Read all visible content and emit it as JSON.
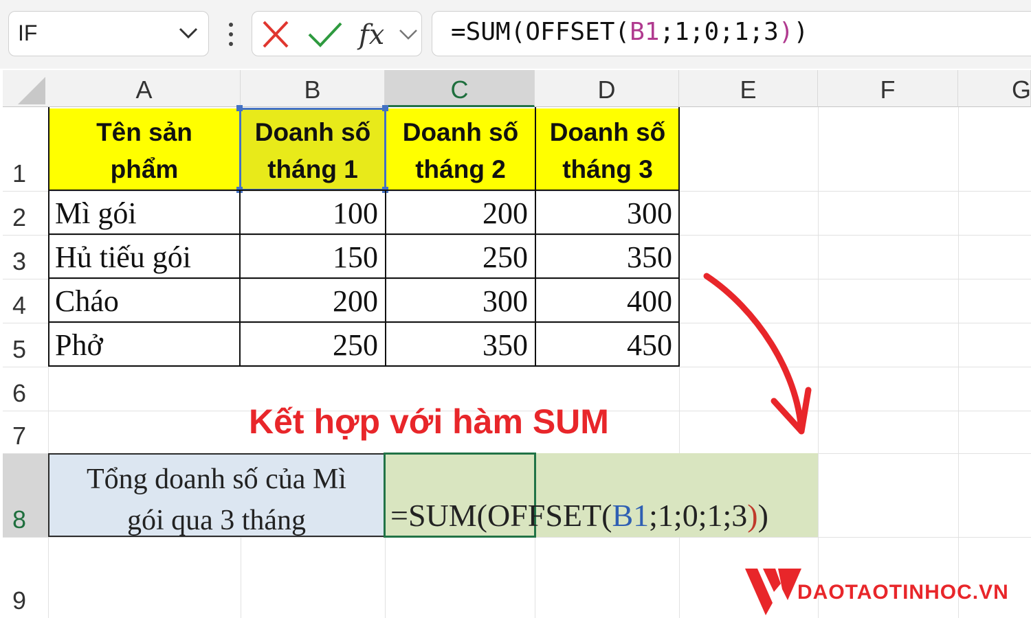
{
  "formula_bar": {
    "name_box": "IF",
    "formula_parts": [
      "=SUM(OFFSET(",
      "B1",
      ";1;0;1;3",
      ")",
      ")"
    ],
    "icons": [
      "chevron-down-icon",
      "more-vert-icon",
      "cancel-icon",
      "enter-icon",
      "fx-icon"
    ]
  },
  "columns": [
    "A",
    "B",
    "C",
    "D",
    "E",
    "F",
    "G"
  ],
  "rows": [
    "1",
    "2",
    "3",
    "4",
    "5",
    "6",
    "7",
    "8",
    "9"
  ],
  "table": {
    "headers": [
      [
        "Tên sản",
        "phẩm"
      ],
      [
        "Doanh số",
        "tháng 1"
      ],
      [
        "Doanh số",
        "tháng 2"
      ],
      [
        "Doanh số",
        "tháng 3"
      ]
    ],
    "rows": [
      [
        "Mì gói",
        "100",
        "200",
        "300"
      ],
      [
        "Hủ tiếu gói",
        "150",
        "250",
        "350"
      ],
      [
        "Cháo",
        "200",
        "300",
        "400"
      ],
      [
        "Phở",
        "250",
        "350",
        "450"
      ]
    ]
  },
  "sum_row": {
    "label_line1": "Tổng doanh số của Mì",
    "label_line2": "gói qua 3 tháng",
    "formula_parts": [
      "=SUM(OFFSET(",
      "B1",
      ";1;0;1;3",
      ")",
      ")"
    ]
  },
  "annotation": "Kết hợp với hàm SUM",
  "logo_text": "DAOTAOTINHOC.VN",
  "colors": {
    "header_fill": "#ffff00",
    "label_fill": "#dce6f1",
    "formula_fill": "#d9e5c0",
    "accent_red": "#e8262a",
    "selection_green": "#217346"
  }
}
